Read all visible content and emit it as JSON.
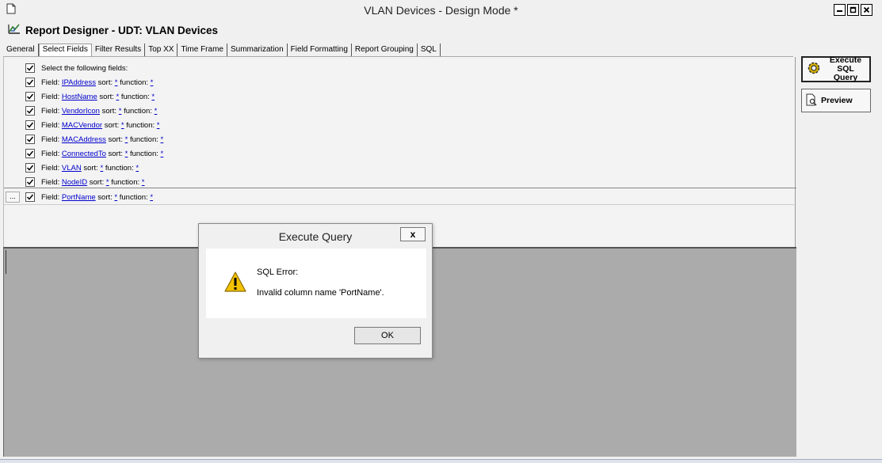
{
  "window": {
    "title": "VLAN Devices - Design Mode *"
  },
  "header": {
    "title": "Report Designer - UDT: VLAN Devices"
  },
  "tabs": [
    {
      "label": "General"
    },
    {
      "label": "Select Fields"
    },
    {
      "label": "Filter Results"
    },
    {
      "label": "Top XX"
    },
    {
      "label": "Time Frame"
    },
    {
      "label": "Summarization"
    },
    {
      "label": "Field Formatting"
    },
    {
      "label": "Report Grouping"
    },
    {
      "label": "SQL"
    }
  ],
  "select_fields": {
    "header": "Select the following fields:",
    "field_label": "Field:",
    "sort_label": "sort:",
    "function_label": "function:",
    "items": [
      {
        "name": "IPAddress",
        "sort": "*",
        "function": "*"
      },
      {
        "name": "HostName",
        "sort": "*",
        "function": "*"
      },
      {
        "name": "VendorIcon",
        "sort": "*",
        "function": "*"
      },
      {
        "name": "MACVendor",
        "sort": "*",
        "function": "*"
      },
      {
        "name": "MACAddress",
        "sort": "*",
        "function": "*"
      },
      {
        "name": "ConnectedTo",
        "sort": "*",
        "function": "*"
      },
      {
        "name": "VLAN",
        "sort": "*",
        "function": "*"
      },
      {
        "name": "NodeID",
        "sort": "*",
        "function": "*"
      },
      {
        "name": "PortName",
        "sort": "*",
        "function": "*"
      }
    ],
    "more_label": "..."
  },
  "side_buttons": {
    "execute_line1": "Execute",
    "execute_line2": "SQL Query",
    "preview": "Preview"
  },
  "dialog": {
    "title": "Execute Query",
    "close_label": "x",
    "message_title": "SQL Error:",
    "message_body": "Invalid column name 'PortName'.",
    "ok_label": "OK"
  }
}
